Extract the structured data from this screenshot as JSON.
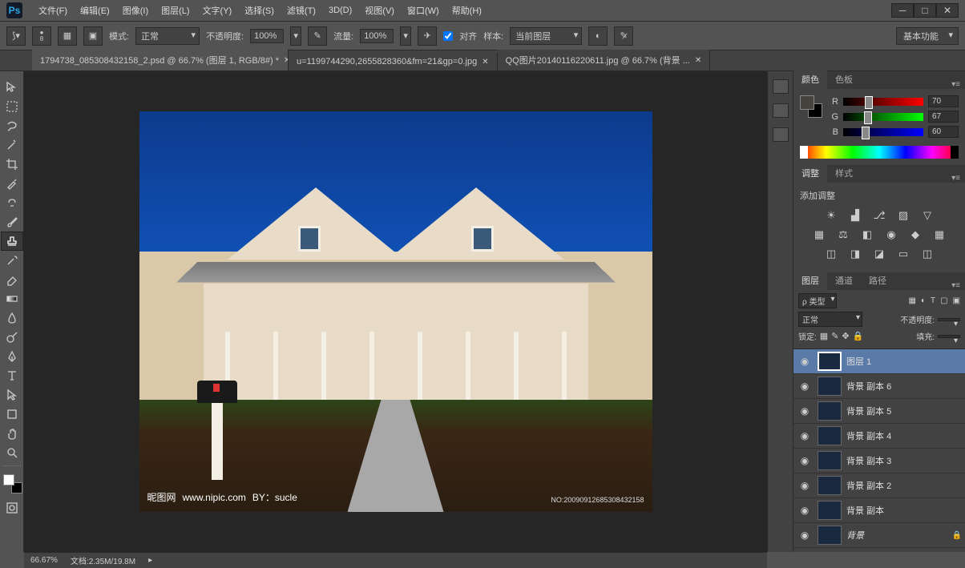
{
  "app": {
    "logo": "Ps"
  },
  "menu": [
    {
      "label": "文件(F)"
    },
    {
      "label": "编辑(E)"
    },
    {
      "label": "图像(I)"
    },
    {
      "label": "图层(L)"
    },
    {
      "label": "文字(Y)"
    },
    {
      "label": "选择(S)"
    },
    {
      "label": "滤镜(T)"
    },
    {
      "label": "3D(D)"
    },
    {
      "label": "视图(V)"
    },
    {
      "label": "窗口(W)"
    },
    {
      "label": "帮助(H)"
    }
  ],
  "options": {
    "brush_size": "8",
    "mode_label": "模式:",
    "mode_value": "正常",
    "opacity_label": "不透明度:",
    "opacity_value": "100%",
    "flow_label": "流量:",
    "flow_value": "100%",
    "align_label": "对齐",
    "sample_label": "样本:",
    "sample_value": "当前图层",
    "workspace": "基本功能"
  },
  "tabs": [
    {
      "label": "1794738_085308432158_2.psd @ 66.7% (图层 1, RGB/8#) *",
      "active": true
    },
    {
      "label": "u=1199744290,2655828360&fm=21&gp=0.jpg",
      "active": false
    },
    {
      "label": "QQ图片20140116220611.jpg @ 66.7% (背景 ...",
      "active": false
    }
  ],
  "canvas": {
    "watermark_site": "昵图网",
    "watermark_url": "www.nipic.com",
    "watermark_by": "BY：sucle",
    "watermark_id": "NO:20090912685308432158"
  },
  "color_panel": {
    "tabs": [
      "颜色",
      "色板"
    ],
    "r_label": "R",
    "r_value": "70",
    "g_label": "G",
    "g_value": "67",
    "b_label": "B",
    "b_value": "60"
  },
  "adjust_panel": {
    "tabs": [
      "调整",
      "样式"
    ],
    "title": "添加调整"
  },
  "layers_panel": {
    "tabs": [
      "图层",
      "通道",
      "路径"
    ],
    "kind_label": "ρ 类型",
    "blend_mode": "正常",
    "opacity_label": "不透明度:",
    "lock_label": "锁定:",
    "fill_label": "填充:",
    "layers": [
      {
        "name": "图层 1",
        "selected": true
      },
      {
        "name": "背景 副本 6"
      },
      {
        "name": "背景 副本 5"
      },
      {
        "name": "背景 副本 4"
      },
      {
        "name": "背景 副本 3"
      },
      {
        "name": "背景 副本 2"
      },
      {
        "name": "背景 副本"
      },
      {
        "name": "背景",
        "locked": true,
        "bg": true
      }
    ]
  },
  "status": {
    "zoom": "66.67%",
    "doc_label": "文档:",
    "doc_size": "2.35M/19.8M"
  }
}
